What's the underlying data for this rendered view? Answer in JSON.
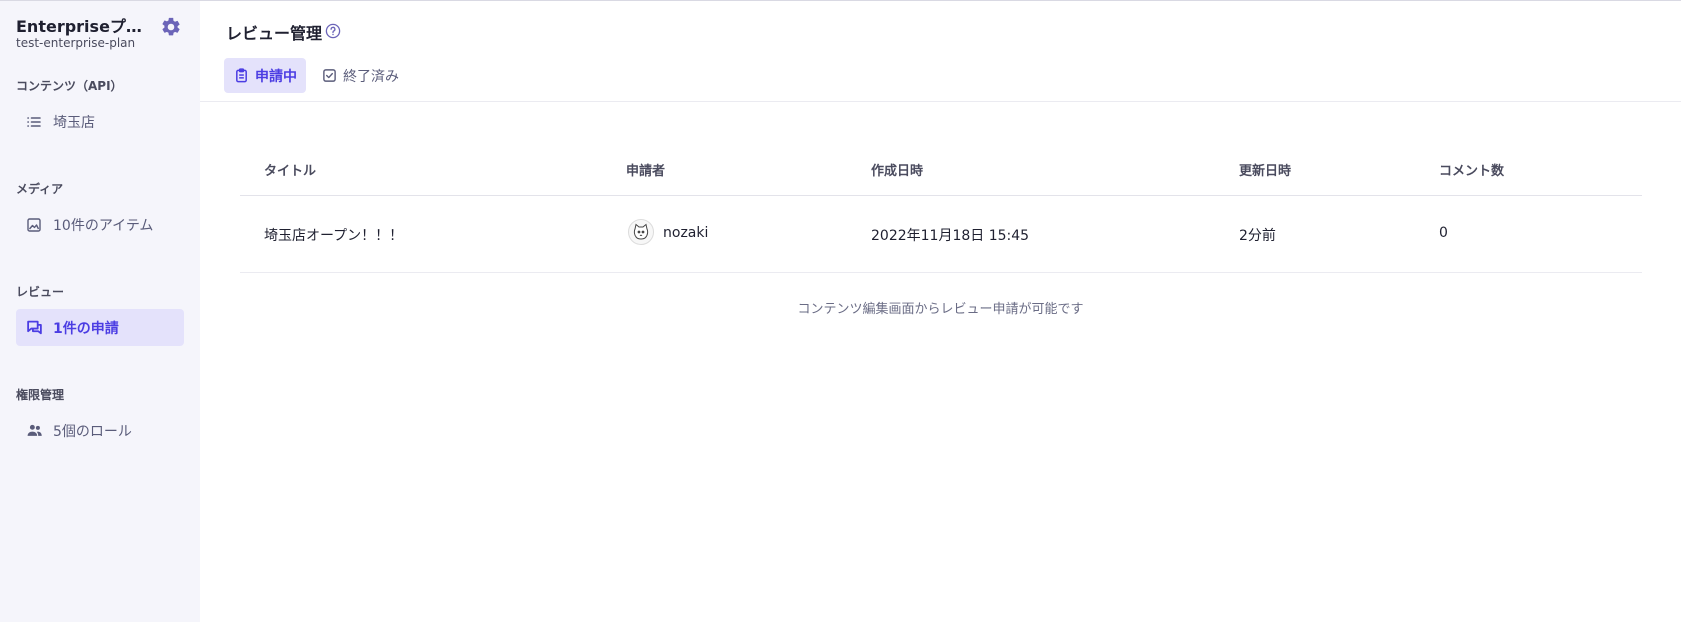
{
  "sidebar": {
    "service_name": "Enterpriseプラ...",
    "service_id": "test-enterprise-plan",
    "sections": [
      {
        "label": "コンテンツ（API）",
        "items": [
          {
            "label": "埼玉店",
            "icon": "list-icon",
            "active": false
          }
        ]
      },
      {
        "label": "メディア",
        "items": [
          {
            "label": "10件のアイテム",
            "icon": "image-icon",
            "active": false
          }
        ]
      },
      {
        "label": "レビュー",
        "items": [
          {
            "label": "1件の申請",
            "icon": "review-chat-icon",
            "active": true
          }
        ]
      },
      {
        "label": "権限管理",
        "items": [
          {
            "label": "5個のロール",
            "icon": "users-icon",
            "active": false
          }
        ]
      }
    ]
  },
  "main": {
    "title": "レビュー管理",
    "tabs": [
      {
        "label": "申請中",
        "icon": "clipboard-icon",
        "active": true
      },
      {
        "label": "終了済み",
        "icon": "checkbox-icon",
        "active": false
      }
    ],
    "table": {
      "columns": [
        "タイトル",
        "申請者",
        "作成日時",
        "更新日時",
        "コメント数"
      ],
      "rows": [
        {
          "title": "埼玉店オープン！！！",
          "applicant": "nozaki",
          "created_at": "2022年11月18日 15:45",
          "updated_at": "2分前",
          "comments": "0"
        }
      ]
    },
    "empty_note": "コンテンツ編集画面からレビュー申請が可能です"
  },
  "colors": {
    "accent": "#4b3de3",
    "active_bg": "#e4e2fb",
    "sidebar_bg": "#f5f5fb",
    "muted_text": "#5a5c7a"
  }
}
